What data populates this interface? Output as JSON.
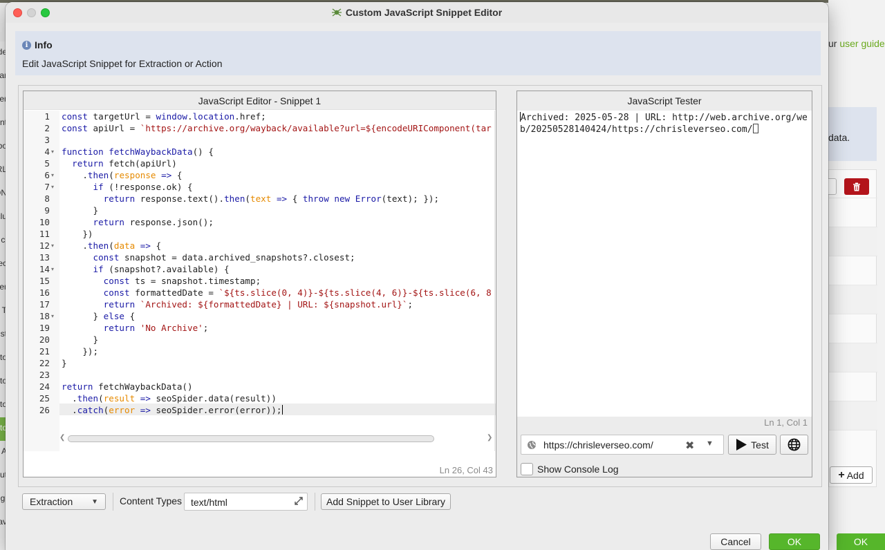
{
  "background": {
    "user_guide_prefix": "ur ",
    "user_guide_link": "user guide",
    "info_text": "data.",
    "add_label": "Add",
    "ok_label": "OK",
    "left_fragments": [
      "de",
      "ar",
      "er",
      "nt",
      "bo",
      "RL",
      "ON",
      "clu",
      "cl",
      "ec",
      "er",
      "T",
      "st",
      "to",
      "to",
      "to",
      "to",
      "l A",
      "ut",
      "gi",
      "av"
    ]
  },
  "window": {
    "title": "Custom JavaScript Snippet Editor"
  },
  "info": {
    "heading": "Info",
    "text": "Edit JavaScript Snippet for Extraction or Action"
  },
  "editor": {
    "title": "JavaScript Editor - Snippet 1",
    "status": "Ln 26, Col 43",
    "line_numbers": [
      "1",
      "2",
      "3",
      "4",
      "5",
      "6",
      "7",
      "8",
      "9",
      "10",
      "11",
      "12",
      "13",
      "14",
      "15",
      "16",
      "17",
      "18",
      "19",
      "20",
      "21",
      "22",
      "23",
      "24",
      "25",
      "26"
    ],
    "lines": [
      "const targetUrl = window.location.href;",
      "const apiUrl = `https://archive.org/wayback/available?url=${encodeURIComponent(tar",
      "",
      "function fetchWaybackData() {",
      "  return fetch(apiUrl)",
      "    .then(response => {",
      "      if (!response.ok) {",
      "        return response.text().then(text => { throw new Error(text); });",
      "      }",
      "      return response.json();",
      "    })",
      "    .then(data => {",
      "      const snapshot = data.archived_snapshots?.closest;",
      "      if (snapshot?.available) {",
      "        const ts = snapshot.timestamp;",
      "        const formattedDate = `${ts.slice(0, 4)}-${ts.slice(4, 6)}-${ts.slice(6, 8",
      "        return `Archived: ${formattedDate} | URL: ${snapshot.url}`;",
      "      } else {",
      "        return 'No Archive';",
      "      }",
      "    });",
      "}",
      "",
      "return fetchWaybackData()",
      "  .then(result => seoSpider.data(result))",
      "  .catch(error => seoSpider.error(error));"
    ]
  },
  "tester": {
    "title": "JavaScript Tester",
    "output": "Archived: 2025-05-28 | URL: http://web.archive.org/web/20250528140424/https://chrisleverseo.com/",
    "status": "Ln 1, Col 1",
    "url_value": "https://chrisleverseo.com/",
    "test_label": "Test",
    "console_label": "Show Console Log",
    "console_checked": false
  },
  "toolbar": {
    "type_value": "Extraction",
    "content_types_label": "Content Types",
    "content_types_value": "text/html",
    "add_snippet_label": "Add Snippet to User Library",
    "cancel_label": "Cancel",
    "ok_label": "OK"
  },
  "colors": {
    "ok_green": "#56b62b",
    "delete_red": "#b3141b",
    "info_bg": "#dde3ee",
    "link_green": "#6aaa1e"
  }
}
